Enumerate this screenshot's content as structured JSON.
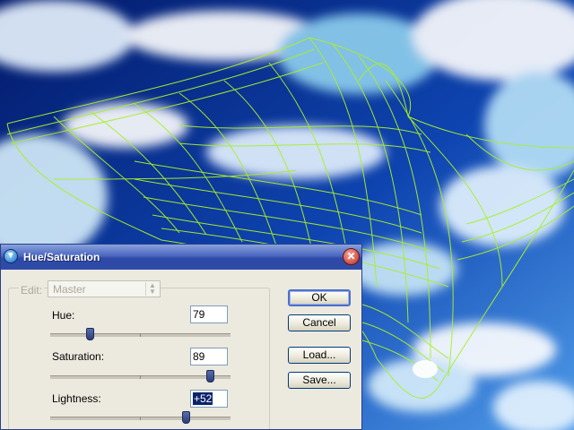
{
  "dialog": {
    "title": "Hue/Saturation",
    "edit_label": "Edit:",
    "edit_value": "Master",
    "sliders": [
      {
        "label": "Hue:",
        "value": "79"
      },
      {
        "label": "Saturation:",
        "value": "89"
      },
      {
        "label": "Lightness:",
        "value": "+52"
      }
    ],
    "buttons": {
      "ok": "OK",
      "cancel": "Cancel",
      "load": "Load...",
      "save": "Save..."
    }
  },
  "icons": {
    "system_menu": "adjust-icon",
    "close": "close-icon",
    "spinner": "updown-chevron-icon"
  },
  "colors": {
    "wireframe": "#a8f02a",
    "sky": "#0b2e86",
    "titlebar": "#3a57b4",
    "close": "#c12b1d"
  }
}
